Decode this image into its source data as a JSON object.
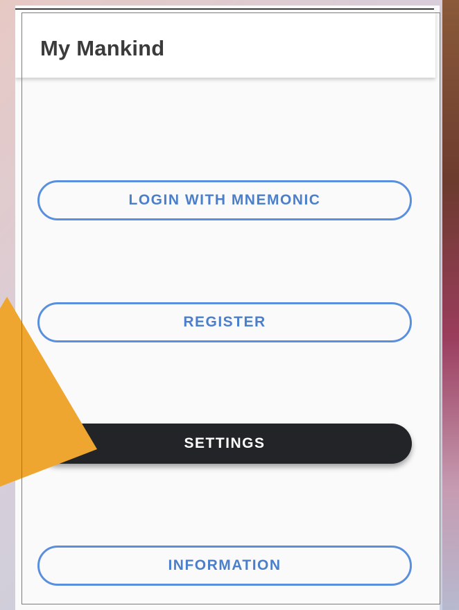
{
  "app_bar": {
    "title": "My Mankind"
  },
  "buttons": {
    "login_mnemonic": "LOGIN WITH MNEMONIC",
    "register": "REGISTER",
    "settings": "SETTINGS",
    "information": "INFORMATION"
  },
  "colors": {
    "accent_blue": "#5a8fdd",
    "button_dark": "#232427",
    "annotation_orange": "#efa630"
  }
}
